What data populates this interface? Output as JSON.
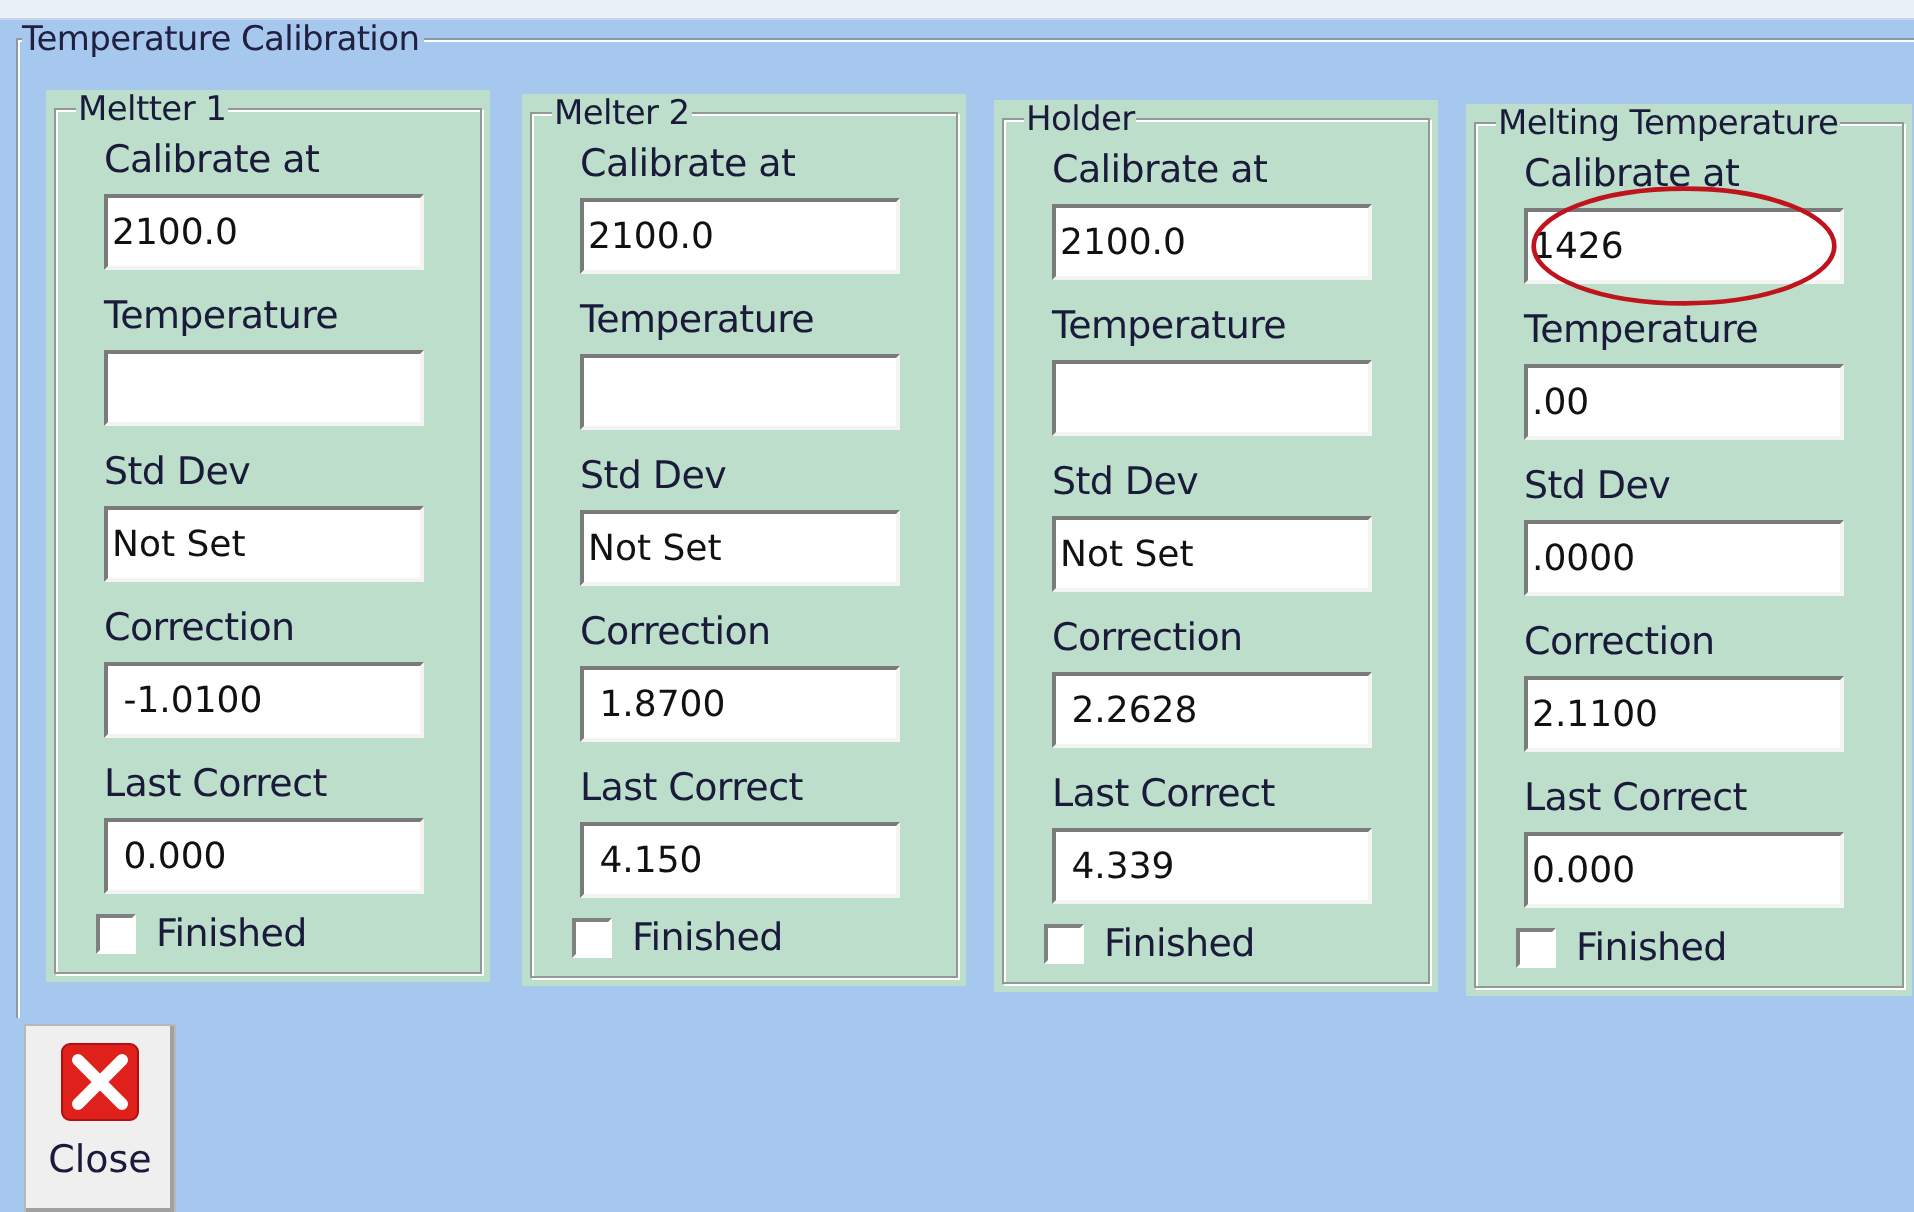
{
  "group": {
    "title": "Temperature Calibration"
  },
  "panels": [
    {
      "title": "Meltter 1",
      "annotated": false,
      "fields": [
        {
          "label": "Calibrate at",
          "value": "2100.0"
        },
        {
          "label": "Temperature"
        },
        {
          "label": "Std Dev",
          "value": "Not Set"
        },
        {
          "label": "Correction",
          "value": " -1.0100"
        },
        {
          "label": "Last Correct",
          "value": " 0.000"
        }
      ],
      "finished": {
        "label": "Finished",
        "checked": false
      }
    },
    {
      "title": "Melter 2",
      "annotated": false,
      "fields": [
        {
          "label": "Calibrate at",
          "value": "2100.0"
        },
        {
          "label": "Temperature"
        },
        {
          "label": "Std Dev",
          "value": "Not Set"
        },
        {
          "label": "Correction",
          "value": " 1.8700"
        },
        {
          "label": "Last Correct",
          "value": " 4.150"
        }
      ],
      "finished": {
        "label": "Finished",
        "checked": false
      }
    },
    {
      "title": "Holder",
      "annotated": false,
      "fields": [
        {
          "label": "Calibrate at",
          "value": "2100.0"
        },
        {
          "label": "Temperature"
        },
        {
          "label": "Std Dev",
          "value": "Not Set"
        },
        {
          "label": "Correction",
          "value": " 2.2628"
        },
        {
          "label": "Last Correct",
          "value": " 4.339"
        }
      ],
      "finished": {
        "label": "Finished",
        "checked": false
      }
    },
    {
      "title": "Melting Temperature",
      "annotated": true,
      "fields": [
        {
          "label": "Calibrate at",
          "value": "1426"
        },
        {
          "label": "Temperature",
          "value": ".00"
        },
        {
          "label": "Std Dev",
          "value": ".0000"
        },
        {
          "label": "Correction",
          "value": "2.1100"
        },
        {
          "label": "Last Correct",
          "value": "0.000"
        }
      ],
      "finished": {
        "label": "Finished",
        "checked": false
      }
    }
  ],
  "close_button": {
    "label": "Close"
  }
}
